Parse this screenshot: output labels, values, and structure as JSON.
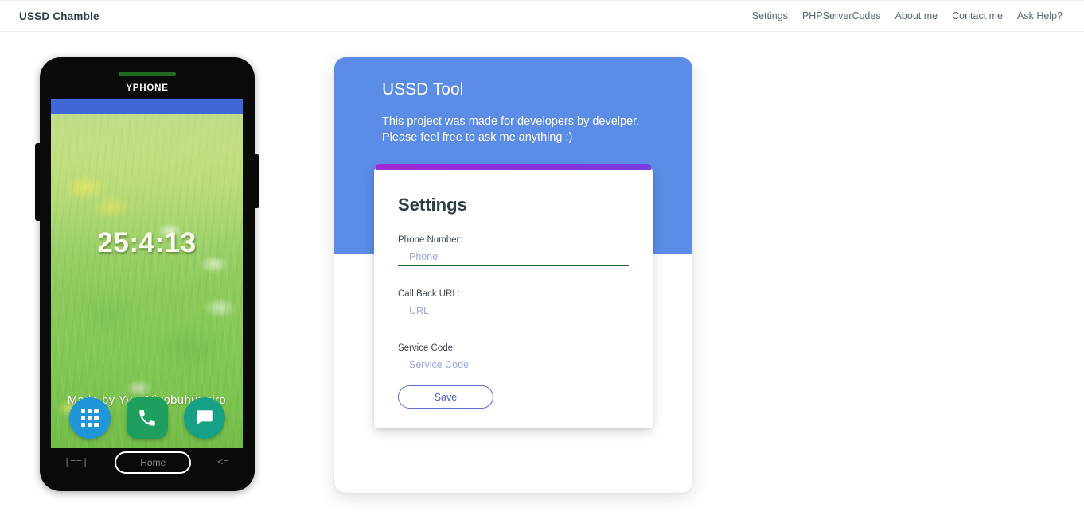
{
  "navbar": {
    "brand": "USSD Chamble",
    "links": [
      {
        "label": "Settings"
      },
      {
        "label": "PHPServerCodes"
      },
      {
        "label": "About me"
      },
      {
        "label": "Contact me"
      },
      {
        "label": "Ask Help?"
      }
    ]
  },
  "phone": {
    "device_label": "YPHONE",
    "clock": "25:4:13",
    "watermark": "Made by YvesNiyobuhungiro",
    "dock": [
      {
        "name": "apps-icon"
      },
      {
        "name": "phone-icon"
      },
      {
        "name": "messages-icon"
      }
    ],
    "navbar": {
      "recents_glyph": "|==|",
      "home_label": "Home",
      "back_glyph": "<="
    }
  },
  "panel": {
    "title": "USSD Tool",
    "description": "This project was made for developers by develper. Please feel free to ask me anything :)"
  },
  "settings": {
    "title": "Settings",
    "fields": [
      {
        "label": "Phone Number:",
        "placeholder": "Phone",
        "value": ""
      },
      {
        "label": "Call Back URL:",
        "placeholder": "URL",
        "value": ""
      },
      {
        "label": "Service Code:",
        "placeholder": "Service Code",
        "value": ""
      }
    ],
    "save_label": "Save"
  },
  "colors": {
    "panel_blue": "#5b8ce6",
    "accent_purple": "#8a31dd",
    "underline_green": "#1d6b2a",
    "status_bar_blue": "#4067d6",
    "save_border": "#5a6fd0"
  }
}
